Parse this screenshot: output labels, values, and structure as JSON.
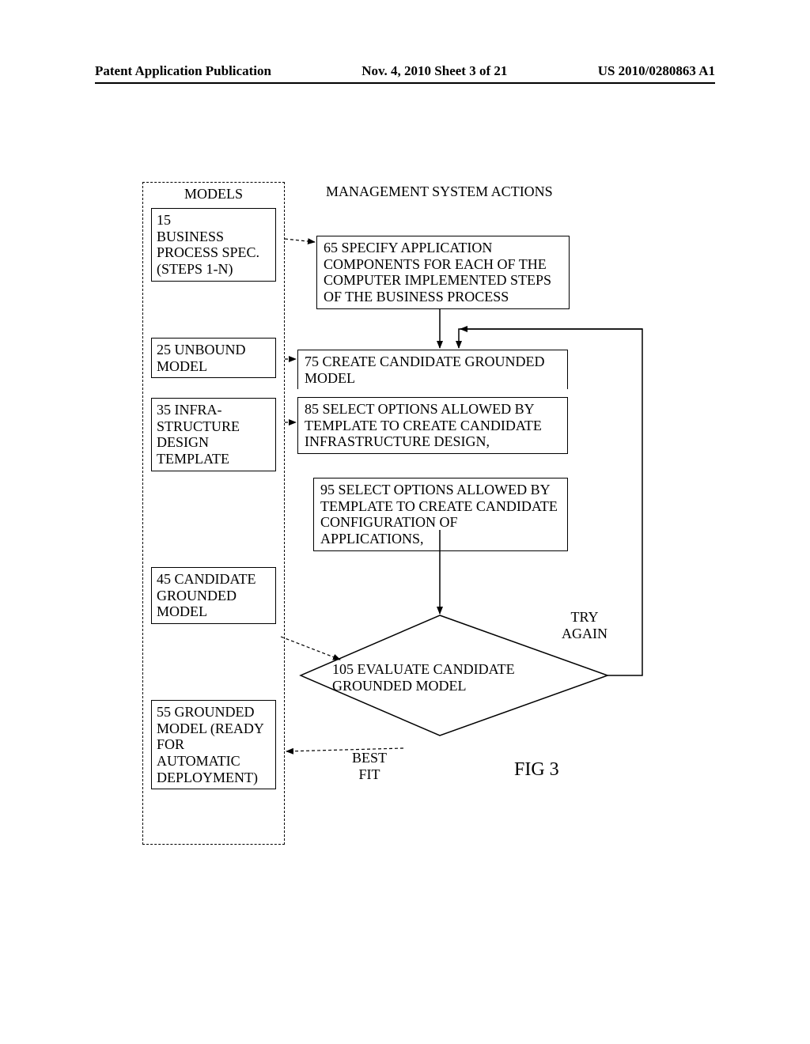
{
  "header": {
    "left": "Patent Application Publication",
    "center": "Nov. 4, 2010  Sheet 3 of 21",
    "right": "US 2010/0280863 A1"
  },
  "figure_label": "FIG 3",
  "models": {
    "title": "MODELS",
    "box15": "15\nBUSINESS PROCESS SPEC.\n(STEPS 1-N)",
    "box25": "25 UNBOUND MODEL",
    "box35": "35 INFRA-STRUCTURE DESIGN TEMPLATE",
    "box45": "45 CANDIDATE GROUNDED MODEL",
    "box55": "55 GROUNDED MODEL (READY FOR AUTOMATIC DEPLOYMENT)"
  },
  "actions": {
    "title": "MANAGEMENT SYSTEM ACTIONS",
    "box65": "65 SPECIFY APPLICATION COMPONENTS FOR EACH OF THE COMPUTER IMPLEMENTED STEPS OF THE BUSINESS PROCESS",
    "box75": "75 CREATE CANDIDATE GROUNDED MODEL",
    "box85": "85 SELECT OPTIONS ALLOWED BY TEMPLATE TO CREATE CANDIDATE INFRASTRUCTURE DESIGN,",
    "box95": "95 SELECT OPTIONS ALLOWED BY TEMPLATE TO CREATE CANDIDATE CONFIGURATION OF APPLICATIONS,"
  },
  "decision": {
    "text": "105 EVALUATE CANDIDATE GROUNDED MODEL",
    "try_again": "TRY AGAIN",
    "best_fit": "BEST FIT"
  }
}
